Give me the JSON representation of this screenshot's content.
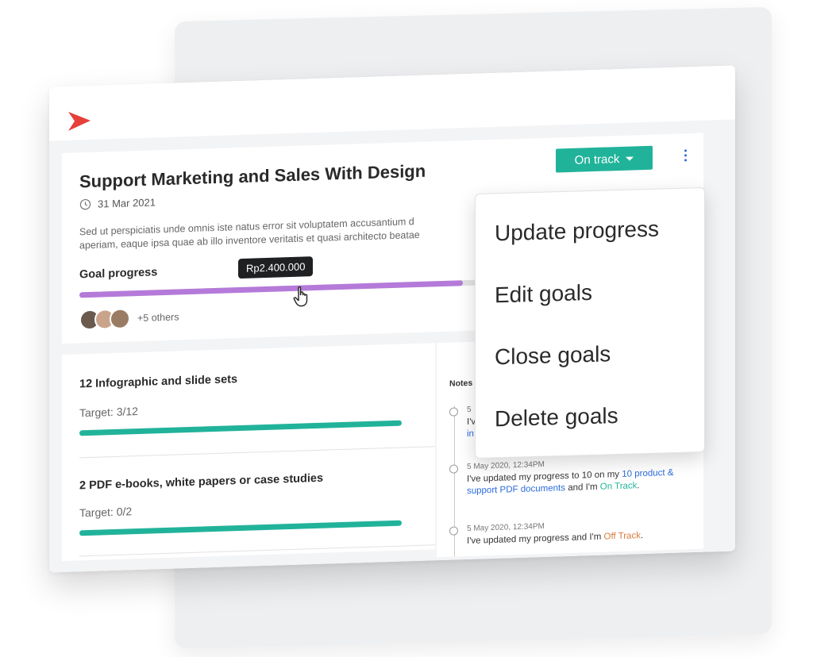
{
  "goal": {
    "title": "Support Marketing and Sales With Design",
    "date": "31 Mar 2021",
    "description_line1": "Sed ut perspiciatis unde omnis iste natus error sit voluptatem accusantium d",
    "description_line2": "aperiam, eaque ipsa quae ab illo inventore veritatis et quasi architecto beatae",
    "progress_label": "Goal progress",
    "progress_value": "Rp2.400.000",
    "progress_fraction": 0.81,
    "others": "+5 others",
    "status": "On track"
  },
  "colors": {
    "brand": "#e6403a",
    "accent_green": "#21b39a",
    "progress_purple": "#b57ad9",
    "link_blue": "#2c6bdc",
    "off_track": "#d87a3a"
  },
  "tasks": [
    {
      "title": "12 Infographic and slide sets",
      "target": "Target: 3/12"
    },
    {
      "title": "2 PDF e-books, white papers or case studies",
      "target": "Target: 0/2"
    }
  ],
  "notes": {
    "label": "Notes",
    "items": [
      {
        "time": "5",
        "line1": "I've",
        "line2": "in"
      },
      {
        "time": "5 May 2020, 12:34PM",
        "pre": "I've updated my progress to 10 on my ",
        "link": "10 product & support PDF documents",
        "mid": " and I'm ",
        "status": "On Track",
        "end": "."
      },
      {
        "time": "5 May 2020, 12:34PM",
        "pre": "I've updated my progress and I'm ",
        "status": "Off Track",
        "end": "."
      }
    ]
  },
  "menu": {
    "items": [
      "Update progress",
      "Edit goals",
      "Close goals",
      "Delete goals"
    ]
  },
  "icons": [
    "logo-icon",
    "clock-icon",
    "caret-down-icon",
    "kebab-menu-icon",
    "hand-cursor-icon"
  ]
}
